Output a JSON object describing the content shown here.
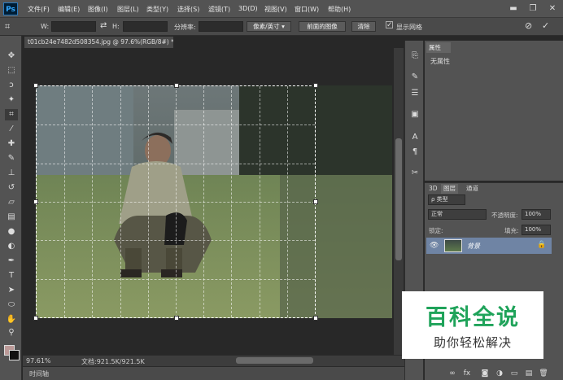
{
  "app": {
    "logo": "Ps"
  },
  "menu": [
    "文件(F)",
    "编辑(E)",
    "图像(I)",
    "图层(L)",
    "类型(Y)",
    "选择(S)",
    "滤镜(T)",
    "3D(D)",
    "视图(V)",
    "窗口(W)",
    "帮助(H)"
  ],
  "window_controls": {
    "minimize": "▬",
    "restore": "❐",
    "close": "✕"
  },
  "options": {
    "w_label": "W:",
    "h_label": "H:",
    "swap": "⇄",
    "res_label": "分辨率:",
    "unit": "像素/英寸",
    "front_image": "前面的图像",
    "clear": "清除",
    "show_grid_label": "显示网格",
    "show_grid_checked": true,
    "cancel_icon": "⊘",
    "commit_icon": "✓"
  },
  "document": {
    "tab_title": "t01cb24e7482d508354.jpg @ 97.6%(RGB/8#) *",
    "close": "×"
  },
  "status": {
    "zoom": "97.61%",
    "doc_info": "文档:921.5K/921.5K"
  },
  "timeline": {
    "label": "时间轴"
  },
  "properties": {
    "tab": "属性",
    "empty_text": "无属性"
  },
  "layers": {
    "tabs": [
      "3D",
      "图层",
      "通道"
    ],
    "kind": "ρ 类型",
    "blend": "正常",
    "opacity_label": "不透明度:",
    "opacity": "100%",
    "lock_label": "锁定:",
    "fill_label": "填充:",
    "fill": "100%",
    "layer_name": "背景"
  },
  "watermark": {
    "title": "百科全说",
    "subtitle": "助你轻松解决"
  },
  "colors": {
    "foreground": "#bc9a98",
    "background": "#111111",
    "watermark_green": "#1fa35a"
  }
}
